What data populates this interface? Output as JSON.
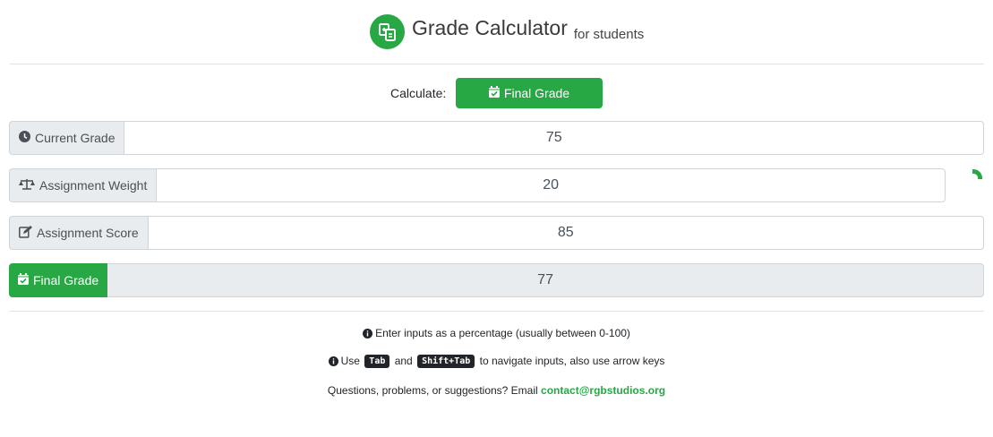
{
  "header": {
    "title": "Grade Calculator",
    "subtitle": "for students",
    "logo_icon": "calculator-icon",
    "accent_color": "#28a745"
  },
  "calculate": {
    "label": "Calculate:",
    "button_label": "Final Grade",
    "button_icon": "calendar-check-icon"
  },
  "inputs": [
    {
      "label": "Current Grade",
      "icon": "clock-icon",
      "value": "75"
    },
    {
      "label": "Assignment Weight",
      "icon": "balance-scale-icon",
      "value": "20"
    },
    {
      "label": "Assignment Score",
      "icon": "edit-icon",
      "value": "85"
    }
  ],
  "result": {
    "label": "Final Grade",
    "icon": "calendar-check-icon",
    "value": "77"
  },
  "footer": {
    "tip1": "Enter inputs as a percentage (usually between 0-100)",
    "tip2_prefix": "Use",
    "tip2_key1": "Tab",
    "tip2_and": "and",
    "tip2_key2": "Shift+Tab",
    "tip2_suffix": "to navigate inputs, also use arrow keys",
    "contact_prefix": "Questions, problems, or suggestions? Email",
    "contact_email": "contact@rgbstudios.org"
  }
}
